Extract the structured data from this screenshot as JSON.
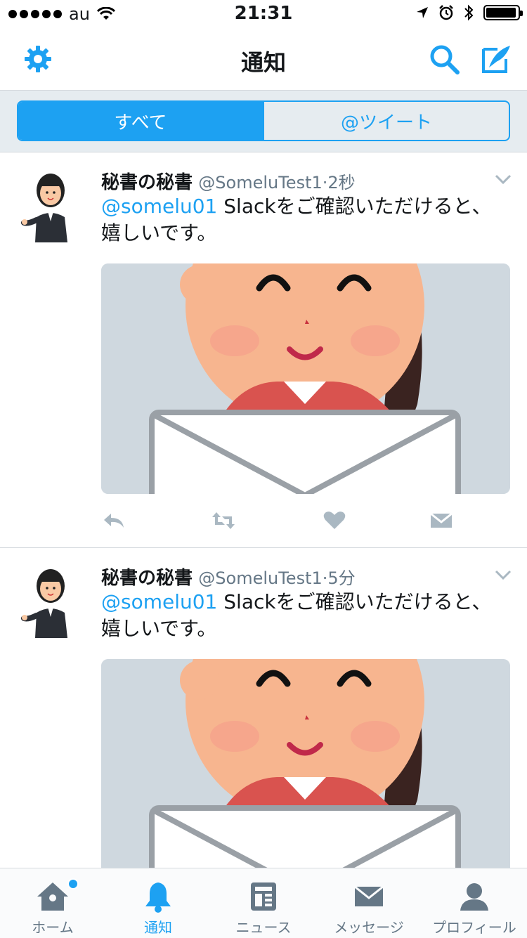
{
  "status_bar": {
    "carrier": "au",
    "time": "21:31",
    "battery_level": 0.95
  },
  "navbar": {
    "title": "通知",
    "left_icon": "gear-icon",
    "right_icons": [
      "search-icon",
      "compose-icon"
    ]
  },
  "segments": {
    "all": "すべて",
    "mentions": "@ツイート",
    "selected": "all"
  },
  "tweets": [
    {
      "name": "秘書の秘書",
      "handle": "@SomeluTest1",
      "separator": "·",
      "time": "2秒",
      "mention": "@somelu01",
      "text": " Slackをご確認いただけると、嬉しいです。"
    },
    {
      "name": "秘書の秘書",
      "handle": "@SomeluTest1",
      "separator": "·",
      "time": "5分",
      "mention": "@somelu01",
      "text": " Slackをご確認いただけると、嬉しいです。"
    }
  ],
  "tabbar": {
    "items": [
      {
        "label": "ホーム",
        "icon": "home-icon"
      },
      {
        "label": "通知",
        "icon": "bell-icon"
      },
      {
        "label": "ニュース",
        "icon": "news-icon"
      },
      {
        "label": "メッセージ",
        "icon": "envelope-icon"
      },
      {
        "label": "プロフィール",
        "icon": "profile-icon"
      }
    ],
    "active_index": 1
  },
  "colors": {
    "accent": "#1da1f2",
    "text": "#14171a",
    "secondary": "#657786",
    "background": "#e6ecf0"
  }
}
